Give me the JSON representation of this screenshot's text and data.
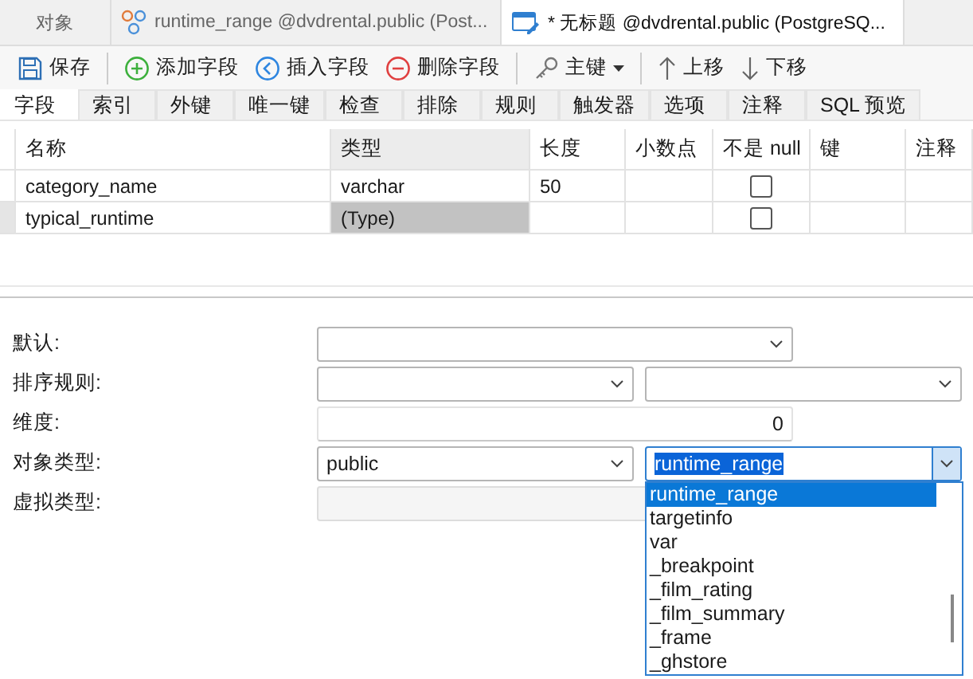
{
  "document_tabs": [
    {
      "label": "对象",
      "kind": "plain",
      "selected": false
    },
    {
      "label": "runtime_range @dvdrental.public (Post...",
      "kind": "type",
      "selected": false
    },
    {
      "label": "* 无标题 @dvdrental.public (PostgreSQ...",
      "kind": "design",
      "selected": true
    }
  ],
  "toolbar": [
    [
      {
        "kind": "save",
        "label": "保存"
      }
    ],
    [
      {
        "kind": "add",
        "label": "添加字段"
      },
      {
        "kind": "insert",
        "label": "插入字段"
      },
      {
        "kind": "delete",
        "label": "删除字段"
      }
    ],
    [
      {
        "kind": "key",
        "label": "主键"
      }
    ],
    [
      {
        "kind": "up",
        "label": "上移"
      },
      {
        "kind": "down",
        "label": "下移"
      }
    ]
  ],
  "field_tabs": [
    {
      "label": "字段",
      "selected": true
    },
    {
      "label": "索引",
      "selected": false
    },
    {
      "label": "外键",
      "selected": false
    },
    {
      "label": "唯一键",
      "selected": false
    },
    {
      "label": "检查",
      "selected": false
    },
    {
      "label": "排除",
      "selected": false
    },
    {
      "label": "规则",
      "selected": false
    },
    {
      "label": "触发器",
      "selected": false
    },
    {
      "label": "选项",
      "selected": false
    },
    {
      "label": "注释",
      "selected": false
    },
    {
      "label": "SQL 预览",
      "selected": false
    }
  ],
  "fields_table": {
    "columns": [
      "名称",
      "类型",
      "长度",
      "小数点",
      "不是 null",
      "键",
      "注释"
    ],
    "rows": [
      {
        "name": "category_name",
        "type": "varchar",
        "length": "50",
        "not_null": false,
        "selected": false
      },
      {
        "name": "typical_runtime",
        "type": "(Type)",
        "not_null": false,
        "selected": true
      }
    ]
  },
  "properties": [
    {
      "label": "默认:",
      "kind": "combo"
    },
    {
      "label": "排序规则:",
      "kind": "combo_pair"
    },
    {
      "label": "维度:",
      "kind": "number",
      "value": "0"
    },
    {
      "label": "对象类型:",
      "kind": "combo_pair",
      "values": [
        "public",
        "runtime_range"
      ],
      "open": true,
      "dropdown": [
        {
          "label": "runtime_range",
          "selected": true
        },
        {
          "label": "targetinfo",
          "selected": false
        },
        {
          "label": "var",
          "selected": false
        },
        {
          "label": "_breakpoint",
          "selected": false
        },
        {
          "label": "_film_rating",
          "selected": false
        },
        {
          "label": "_film_summary",
          "selected": false
        },
        {
          "label": "_frame",
          "selected": false
        },
        {
          "label": "_ghstore",
          "selected": false
        }
      ]
    },
    {
      "label": "虚拟类型:",
      "kind": "text"
    }
  ]
}
